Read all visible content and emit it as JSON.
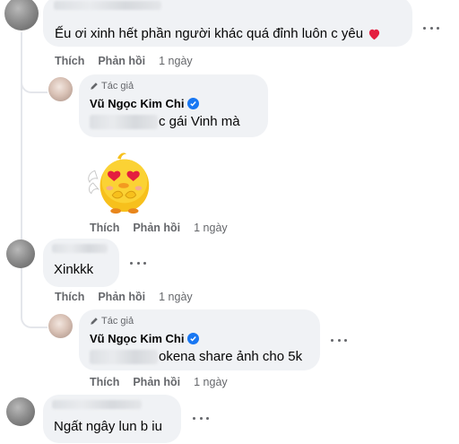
{
  "comments": [
    {
      "text": "Ếu ơi xinh hết phần người khác quá đỉnh luôn c yêu",
      "actions": {
        "like": "Thích",
        "reply": "Phản hồi",
        "time": "1 ngày"
      },
      "reply": {
        "author_tag": "Tác giả",
        "author": "Vũ Ngọc Kim Chi",
        "text": "c gái Vinh mà",
        "sticker": "chick-heart-eyes-sticker",
        "actions": {
          "like": "Thích",
          "reply": "Phản hồi",
          "time": "1 ngày"
        }
      }
    },
    {
      "text": "Xinkkk",
      "actions": {
        "like": "Thích",
        "reply": "Phản hồi",
        "time": "1 ngày"
      },
      "reply": {
        "author_tag": "Tác giả",
        "author": "Vũ Ngọc Kim Chi",
        "text": "okena share ảnh cho 5k",
        "actions": {
          "like": "Thích",
          "reply": "Phản hồi",
          "time": "1 ngày"
        }
      }
    },
    {
      "text": "Ngất ngây lun b iu"
    }
  ],
  "colors": {
    "bubble": "#f0f2f5",
    "secondary_text": "#65676b",
    "verified": "#1877f2",
    "heart": "#e41e3f"
  }
}
